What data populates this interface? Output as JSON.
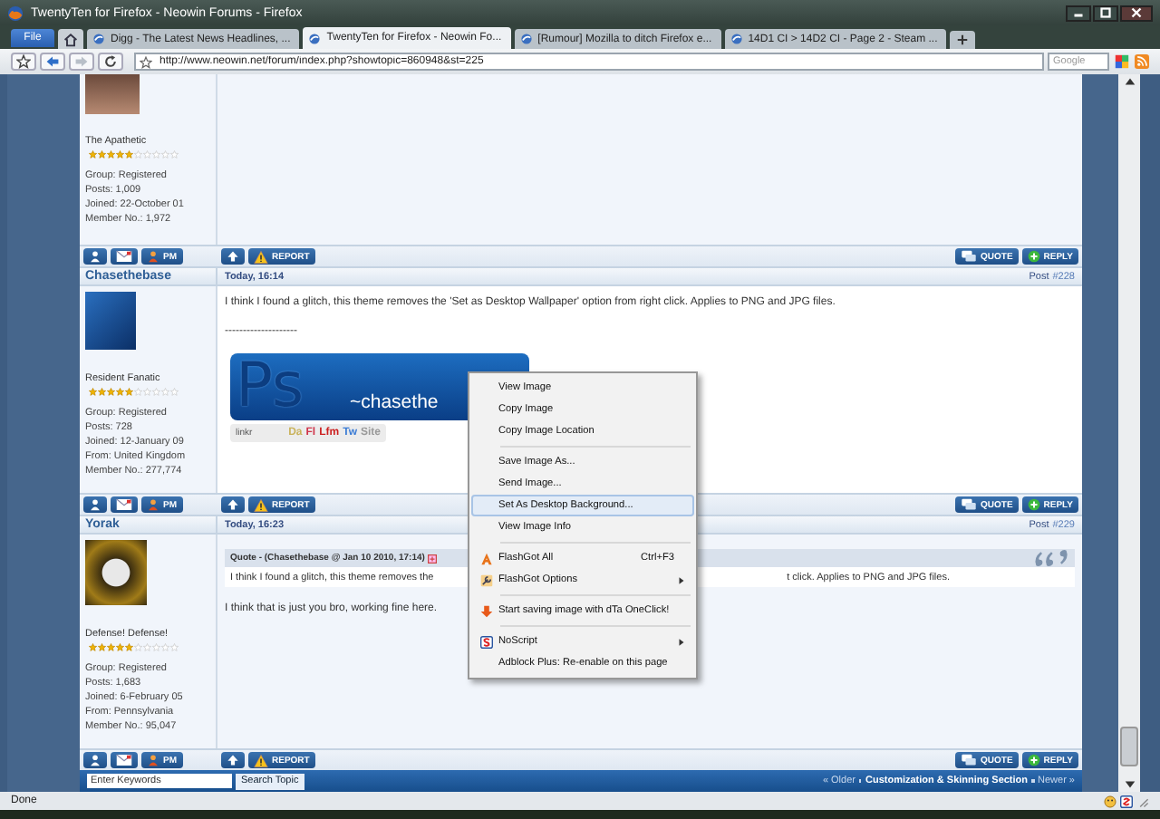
{
  "window": {
    "title": "TwentyTen for Firefox - Neowin Forums - Firefox"
  },
  "menu_button": "File",
  "tabs": [
    {
      "label": "Digg - The Latest News Headlines, ...",
      "selected": false
    },
    {
      "label": "TwentyTen for Firefox - Neowin Fo...",
      "selected": true
    },
    {
      "label": "[Rumour] Mozilla to ditch Firefox e...",
      "selected": false
    },
    {
      "label": "14D1 CI > 14D2 CI - Page 2 - Steam ...",
      "selected": false
    }
  ],
  "address_bar": {
    "url": "http://www.neowin.net/forum/index.php?showtopic=860948&st=225"
  },
  "search_bar": {
    "placeholder": "Google"
  },
  "posts": [
    {
      "user_title": "The Apathetic",
      "stars": 5,
      "details": [
        "Group: Registered",
        "Posts: 1,009",
        "Joined: 22-October 01",
        "Member No.: 1,972"
      ],
      "actions": {
        "pm": "PM",
        "report": "REPORT",
        "quote": "QUOTE",
        "reply": "REPLY"
      }
    },
    {
      "author": "Chasethebase",
      "time": "Today, 16:14",
      "post_label": "Post",
      "number": "#228",
      "user_title": "Resident Fanatic",
      "stars": 5,
      "details": [
        "Group: Registered",
        "Posts: 728",
        "Joined: 12-January 09",
        "From: United Kingdom",
        "Member No.: 277,774"
      ],
      "body": [
        {
          "kind": "text",
          "text": "I think I found a glitch, this theme removes the 'Set as Desktop Wallpaper' option from right click. Applies to PNG and JPG files."
        },
        {
          "kind": "text",
          "text": "--------------------"
        },
        {
          "kind": "signature",
          "logo": "Ps",
          "caption": "~chasethe",
          "links_label": "linkr",
          "links": [
            {
              "label": "Da",
              "color": "#c9b25a"
            },
            {
              "label": "Fl",
              "color": "#d0344a"
            },
            {
              "label": "Lfm",
              "color": "#cc2020"
            },
            {
              "label": "Tw",
              "color": "#3a7bd5"
            },
            {
              "label": "Site",
              "color": "#9a9a9a"
            }
          ]
        }
      ],
      "actions": {
        "pm": "PM",
        "report": "REPORT",
        "quote": "QUOTE",
        "reply": "REPLY"
      }
    },
    {
      "author": "Yorak",
      "time": "Today, 16:23",
      "post_label": "Post",
      "number": "#229",
      "user_title": "Defense! Defense!",
      "stars": 5,
      "details": [
        "Group: Registered",
        "Posts: 1,683",
        "Joined: 6-February 05",
        "From: Pennsylvania",
        "Member No.: 95,047"
      ],
      "body": [
        {
          "kind": "quote",
          "header": "Quote - (Chasethebase @ Jan 10 2010, 17:14)",
          "text_start": "I think I found a glitch, this theme removes the",
          "text_end": "t click. Applies to PNG and JPG files."
        },
        {
          "kind": "text",
          "text": "I think that is just you bro, working fine here."
        }
      ],
      "actions": {
        "pm": "PM",
        "report": "REPORT",
        "quote": "QUOTE",
        "reply": "REPLY"
      }
    }
  ],
  "context_menu": {
    "items": [
      {
        "kind": "item",
        "label": "View Image",
        "selected": false
      },
      {
        "kind": "item",
        "label": "Copy Image",
        "selected": false
      },
      {
        "kind": "item",
        "label": "Copy Image Location",
        "selected": false
      },
      {
        "kind": "separator"
      },
      {
        "kind": "item",
        "label": "Save Image As...",
        "selected": false
      },
      {
        "kind": "item",
        "label": "Send Image...",
        "selected": false
      },
      {
        "kind": "item",
        "label": "Set As Desktop Background...",
        "selected": true
      },
      {
        "kind": "item",
        "label": "View Image Info",
        "selected": false
      },
      {
        "kind": "separator"
      },
      {
        "kind": "item",
        "label": "FlashGot All",
        "shortcut": "Ctrl+F3",
        "selected": false
      },
      {
        "kind": "item",
        "label": "FlashGot Options",
        "submenu": true,
        "selected": false
      },
      {
        "kind": "separator"
      },
      {
        "kind": "item",
        "label": "Start saving image with dTa OneClick!",
        "selected": false
      },
      {
        "kind": "separator"
      },
      {
        "kind": "item",
        "label": "NoScript",
        "submenu": true,
        "selected": false
      },
      {
        "kind": "item",
        "label": "Adblock Plus: Re-enable on this page",
        "selected": false
      }
    ]
  },
  "topic_search": {
    "placeholder": "Enter Keywords",
    "button": "Search Topic"
  },
  "topic_nav": {
    "older": "« Older",
    "section": "Customization & Skinning Section",
    "newer": "Newer »"
  },
  "status_bar": {
    "text": "Done"
  }
}
